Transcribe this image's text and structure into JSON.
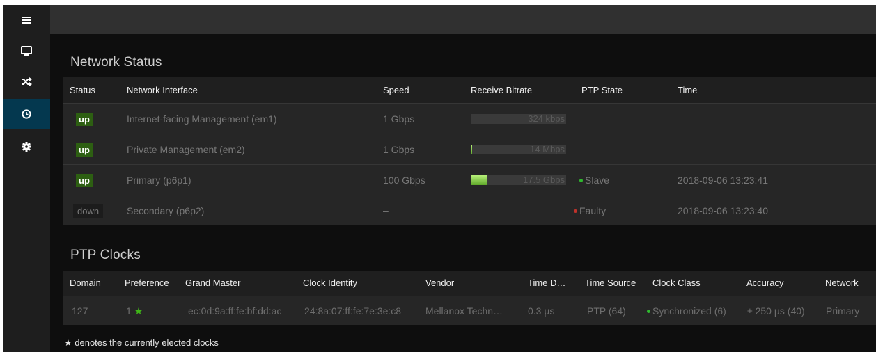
{
  "sidebar": {
    "items": [
      {
        "icon": "hamburger-menu-icon"
      },
      {
        "icon": "monitor-icon"
      },
      {
        "icon": "shuffle-icon"
      },
      {
        "icon": "clock-icon",
        "active": true
      },
      {
        "icon": "gear-icon"
      }
    ]
  },
  "network_status": {
    "title": "Network Status",
    "headers": [
      "Status",
      "Network Interface",
      "Speed",
      "Receive Bitrate",
      "PTP State",
      "Time"
    ],
    "rows": [
      {
        "status": "up",
        "name": "Internet-facing Management",
        "iface": "(em1)",
        "speed": "1 Gbps",
        "bitrate": "324 kbps",
        "bitrate_fill": 0.0,
        "ptp_state": "",
        "ptp_dot": "",
        "time": ""
      },
      {
        "status": "up",
        "name": "Private Management",
        "iface": "(em2)",
        "speed": "1 Gbps",
        "bitrate": "14 Mbps",
        "bitrate_fill": 0.014,
        "ptp_state": "",
        "ptp_dot": "",
        "time": ""
      },
      {
        "status": "up",
        "name": "Primary",
        "iface": "(p6p1)",
        "speed": "100 Gbps",
        "bitrate": "17.5 Gbps",
        "bitrate_fill": 0.175,
        "ptp_state": "Slave",
        "ptp_dot": "#2fb82f",
        "time": "2018-09-06 13:23:41"
      },
      {
        "status": "down",
        "name": "Secondary",
        "iface": "(p6p2)",
        "speed": "–",
        "bitrate": "",
        "bitrate_fill": null,
        "ptp_state": "Faulty",
        "ptp_dot": "#c0322b",
        "time": "2018-09-06 13:23:40"
      }
    ]
  },
  "ptp_clocks": {
    "title": "PTP Clocks",
    "headers": [
      "Domain",
      "Preference",
      "Grand Master",
      "Clock Identity",
      "Vendor",
      "Time D…",
      "Time Source",
      "Clock Class",
      "Accuracy",
      "Network"
    ],
    "rows": [
      {
        "domain": "127",
        "preference": "1",
        "preferred": true,
        "grand_master": "ec:0d:9a:ff:fe:bf:dd:ac",
        "clock_identity": "24:8a:07:ff:fe:7e:3e:c8",
        "vendor": "Mellanox Techn…",
        "time_d": "0.3 µs",
        "time_source": "PTP",
        "time_source_code": "(64)",
        "clock_class": "Synchronized",
        "clock_class_code": "(6)",
        "clock_dot": "#2fb82f",
        "accuracy": "± 250 µs",
        "accuracy_code": "(40)",
        "network": "Primary"
      }
    ]
  },
  "footnote": "★ denotes the currently elected clocks",
  "colors": {
    "accent_active": "#04384f",
    "up_badge": "#2d5f12",
    "ok": "#2fb82f",
    "fault": "#c0322b",
    "star": "#3fb618"
  }
}
